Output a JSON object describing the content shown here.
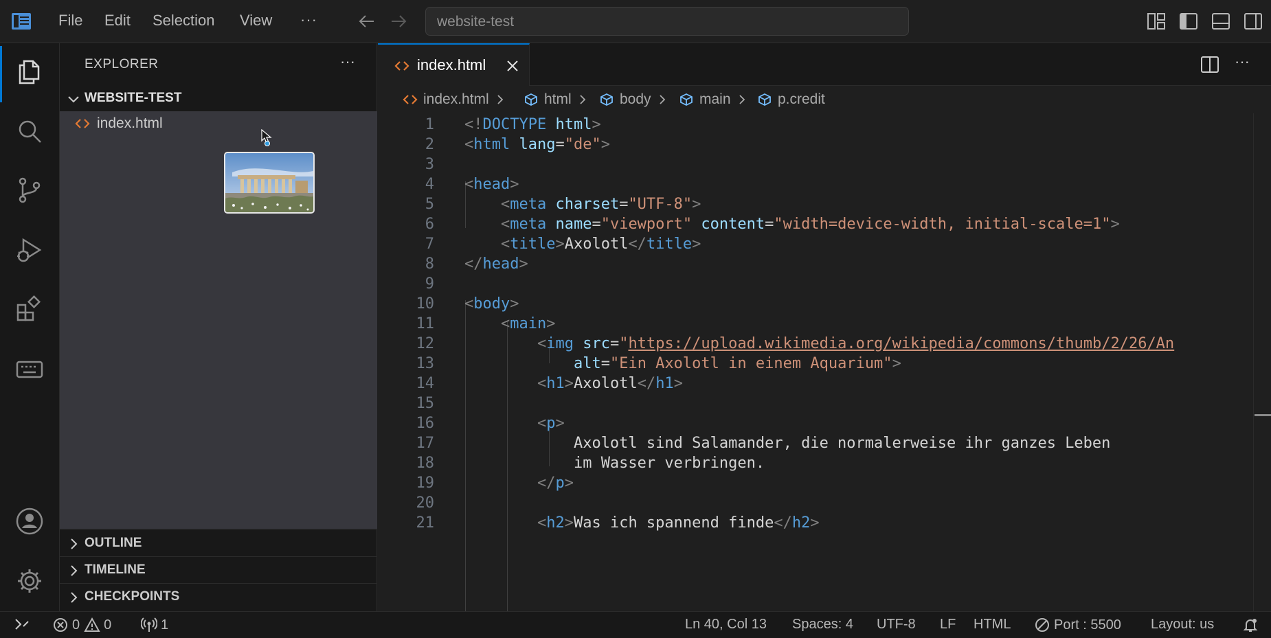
{
  "titlebar": {
    "menu": [
      "File",
      "Edit",
      "Selection",
      "View"
    ],
    "more": "···",
    "search_text": "website-test"
  },
  "sidebar": {
    "title": "EXPLORER",
    "more": "···",
    "folder": "WEBSITE-TEST",
    "files": [
      "index.html"
    ],
    "sections": [
      "OUTLINE",
      "TIMELINE",
      "CHECKPOINTS"
    ]
  },
  "editor": {
    "tab_label": "index.html",
    "more": "···",
    "breadcrumbs": [
      "index.html",
      "html",
      "body",
      "main",
      "p.credit"
    ],
    "line_numbers": [
      "1",
      "2",
      "3",
      "4",
      "5",
      "6",
      "7",
      "8",
      "9",
      "10",
      "11",
      "12",
      "13",
      "14",
      "15",
      "16",
      "17",
      "18",
      "19",
      "20",
      "21"
    ],
    "code": {
      "doctype": "html",
      "lang_value": "\"de\"",
      "charset_value": "\"UTF-8\"",
      "viewport_value": "\"viewport\"",
      "content_value": "\"width=device-width, initial-scale=1\"",
      "title_text": "Axolotl",
      "img_src_value": "https://upload.wikimedia.org/wikipedia/commons/thumb/2/26/An",
      "img_alt_value": "\"Ein Axolotl in einem Aquarium\"",
      "h1_text": "Axolotl",
      "p_line1": "Axolotl sind Salamander, die normalerweise ihr ganzes Leben",
      "p_line2": "im Wasser verbringen.",
      "h2_text": "Was ich spannend finde"
    }
  },
  "statusbar": {
    "errors": "0",
    "warnings": "0",
    "ports_count": "1",
    "cursor_position": "Ln 40, Col 13",
    "indentation": "Spaces: 4",
    "encoding": "UTF-8",
    "line_ending": "LF",
    "language": "HTML",
    "live_server": "Port : 5500",
    "keyboard_layout": "Layout: us"
  },
  "colors": {
    "accent": "#0078d4",
    "tag": "#569cd6",
    "attribute": "#9cdcfe",
    "string": "#ce9178"
  }
}
